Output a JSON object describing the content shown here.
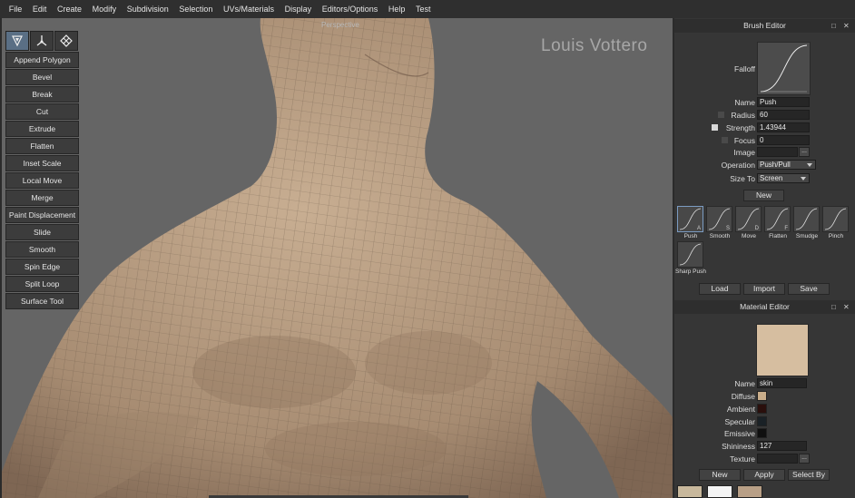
{
  "menu": [
    "File",
    "Edit",
    "Create",
    "Modify",
    "Subdivision",
    "Selection",
    "UVs/Materials",
    "Display",
    "Editors/Options",
    "Help",
    "Test"
  ],
  "viewport": {
    "label": "Perspective",
    "watermark": "Louis Vottero"
  },
  "tool_icons": [
    "brush-tool-icon",
    "transform-tool-icon",
    "mesh-tool-icon"
  ],
  "tools": [
    "Append Polygon",
    "Bevel",
    "Break",
    "Cut",
    "Extrude",
    "Flatten",
    "Inset Scale",
    "Local Move",
    "Merge",
    "Paint Displacement",
    "Slide",
    "Smooth",
    "Spin Edge",
    "Split Loop",
    "Surface Tool"
  ],
  "brush_editor": {
    "title": "Brush Editor",
    "falloff_label": "Falloff",
    "fields": {
      "name_label": "Name",
      "name_value": "Push",
      "radius_label": "Radius",
      "radius_value": "60",
      "strength_label": "Strength",
      "strength_value": "1.43944",
      "focus_label": "Focus",
      "focus_value": "0",
      "image_label": "Image",
      "image_value": "",
      "image_button": "...",
      "operation_label": "Operation",
      "operation_value": "Push/Pull",
      "size_to_label": "Size To",
      "size_to_value": "Screen"
    },
    "new_button": "New",
    "brushes": [
      {
        "name": "Push",
        "key": "A"
      },
      {
        "name": "Smooth",
        "key": "S"
      },
      {
        "name": "Move",
        "key": "D"
      },
      {
        "name": "Flatten",
        "key": "F"
      },
      {
        "name": "Smudge",
        "key": ""
      },
      {
        "name": "Pinch",
        "key": ""
      },
      {
        "name": "Sharp Push",
        "key": ""
      }
    ],
    "load_button": "Load",
    "import_button": "Import",
    "save_button": "Save"
  },
  "material_editor": {
    "title": "Material Editor",
    "preview_color": "#d6bea0",
    "name_label": "Name",
    "name_value": "skin",
    "diffuse_label": "Diffuse",
    "diffuse_color": "#c9ad8a",
    "ambient_label": "Ambient",
    "ambient_color": "#2a0f0c",
    "specular_label": "Specular",
    "specular_color": "#1a2126",
    "emissive_label": "Emissive",
    "emissive_color": "#101010",
    "shininess_label": "Shininess",
    "shininess_value": "127",
    "texture_label": "Texture",
    "texture_value": "",
    "texture_button": "...",
    "new_button": "New",
    "apply_button": "Apply",
    "select_by_button": "Select By",
    "materials": [
      "#c8b89c",
      "#f4f4f4",
      "#b89f86"
    ]
  },
  "colors": {
    "skin": "#b89f86",
    "viewport_bg": "#656565"
  }
}
